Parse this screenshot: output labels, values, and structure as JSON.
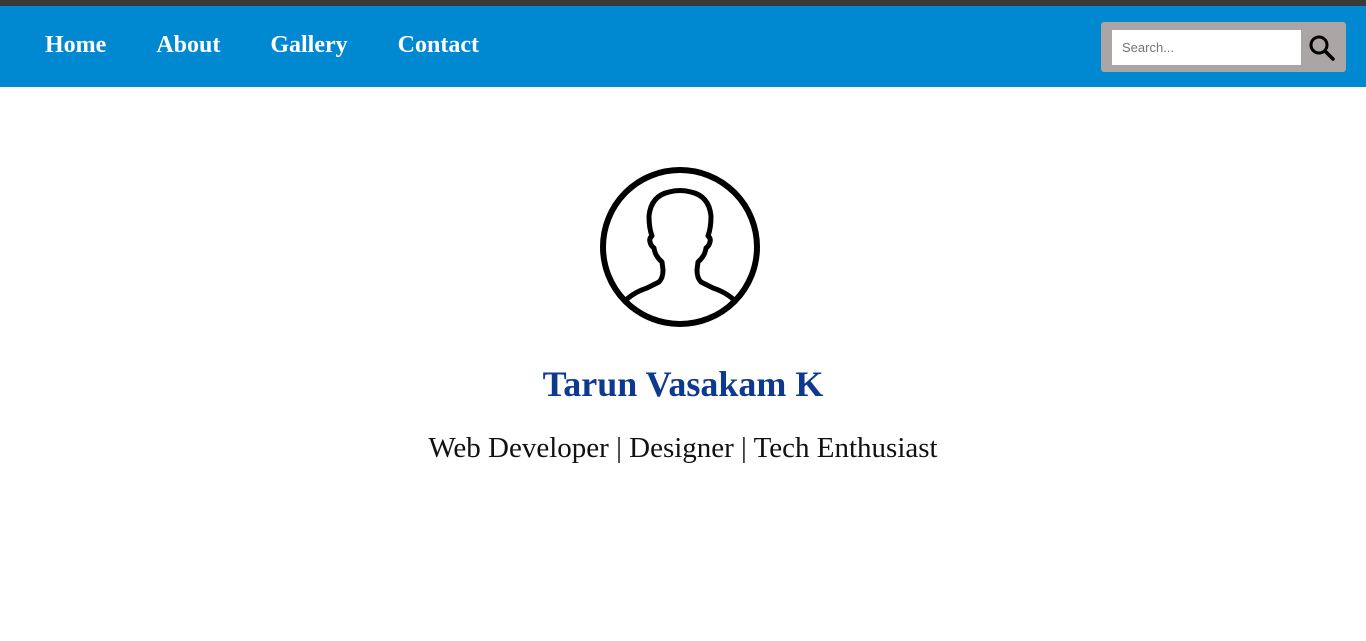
{
  "nav": {
    "links": [
      {
        "label": "Home"
      },
      {
        "label": "About"
      },
      {
        "label": "Gallery"
      },
      {
        "label": "Contact"
      }
    ],
    "search": {
      "placeholder": "Search...",
      "icon": "search-icon"
    }
  },
  "profile": {
    "avatar_icon": "user-silhouette-icon",
    "name": "Tarun Vasakam K",
    "tagline": "Web Developer | Designer | Tech Enthusiast"
  },
  "colors": {
    "navbar": "#0088d1",
    "top_strip": "#3a3a3a",
    "name": "#0d3a8f",
    "search_box": "#aaa6a6"
  }
}
